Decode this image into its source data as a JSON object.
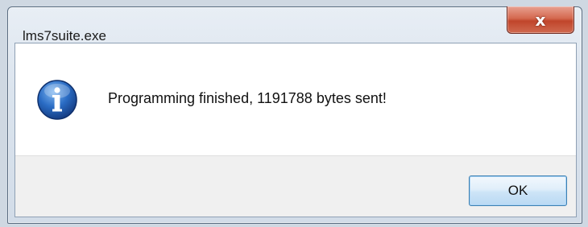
{
  "window": {
    "title": "lms7suite.exe",
    "close_glyph": "x"
  },
  "dialog": {
    "icon": "info-icon",
    "message": "Programming finished, 1191788 bytes sent!",
    "ok_label": "OK"
  },
  "colors": {
    "close_button": "#c8452b",
    "ok_border": "#3c7fb1",
    "info_icon": "#2a5fb0"
  }
}
